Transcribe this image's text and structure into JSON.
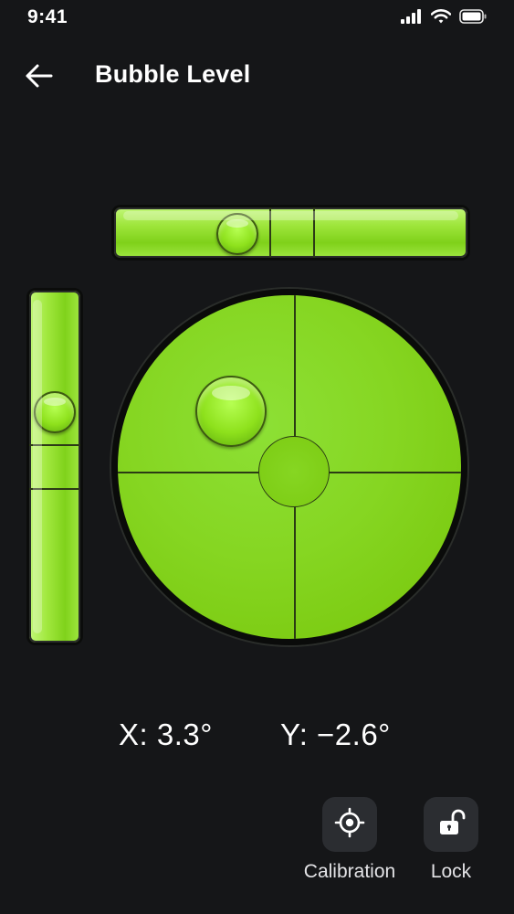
{
  "status_bar": {
    "time": "9:41",
    "icons": [
      "signal-icon",
      "wifi-icon",
      "battery-icon"
    ]
  },
  "header": {
    "back_icon": "arrow-left-icon",
    "title": "Bubble Level"
  },
  "level": {
    "x_angle": 3.3,
    "y_angle": -2.6,
    "bubble_color": "#8ee11c",
    "vial_color": "#86d622"
  },
  "readouts": {
    "x_text": "X: 3.3°",
    "y_text": "Y: −2.6°"
  },
  "actions": [
    {
      "label": "Calibration",
      "icon": "crosshair-icon"
    },
    {
      "label": "Lock",
      "icon": "unlock-icon"
    }
  ],
  "colors": {
    "background": "#151618",
    "button_bg": "#2b2d31",
    "text": "#ffffff"
  }
}
